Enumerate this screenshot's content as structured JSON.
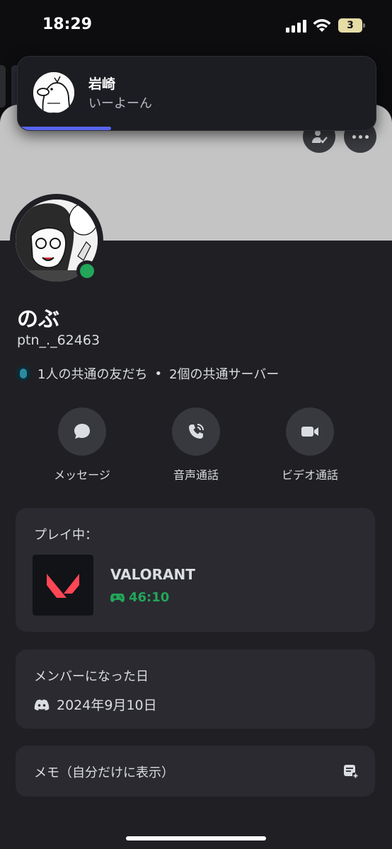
{
  "status_bar": {
    "time": "18:29",
    "battery": "3"
  },
  "notification": {
    "sender": "岩崎",
    "message": "いーよーん",
    "progress": 0.26
  },
  "profile": {
    "display_name": "のぶ",
    "username": "ptn_._62463",
    "mutual_friends": "1人の共通の友だち",
    "separator": "•",
    "mutual_servers": "2個の共通サーバー"
  },
  "actions": [
    {
      "label": "メッセージ",
      "icon": "chat-bubble-icon"
    },
    {
      "label": "音声通話",
      "icon": "phone-icon"
    },
    {
      "label": "ビデオ通話",
      "icon": "video-camera-icon"
    }
  ],
  "activity": {
    "heading": "プレイ中：",
    "game": "VALORANT",
    "elapsed": "46:10"
  },
  "member_since": {
    "heading": "メンバーになった日",
    "date": "2024年9月10日"
  },
  "note": {
    "label": "メモ（自分だけに表示）"
  },
  "colors": {
    "online": "#23a55a",
    "accent": "#5865f2",
    "valorant": "#ff4655"
  }
}
